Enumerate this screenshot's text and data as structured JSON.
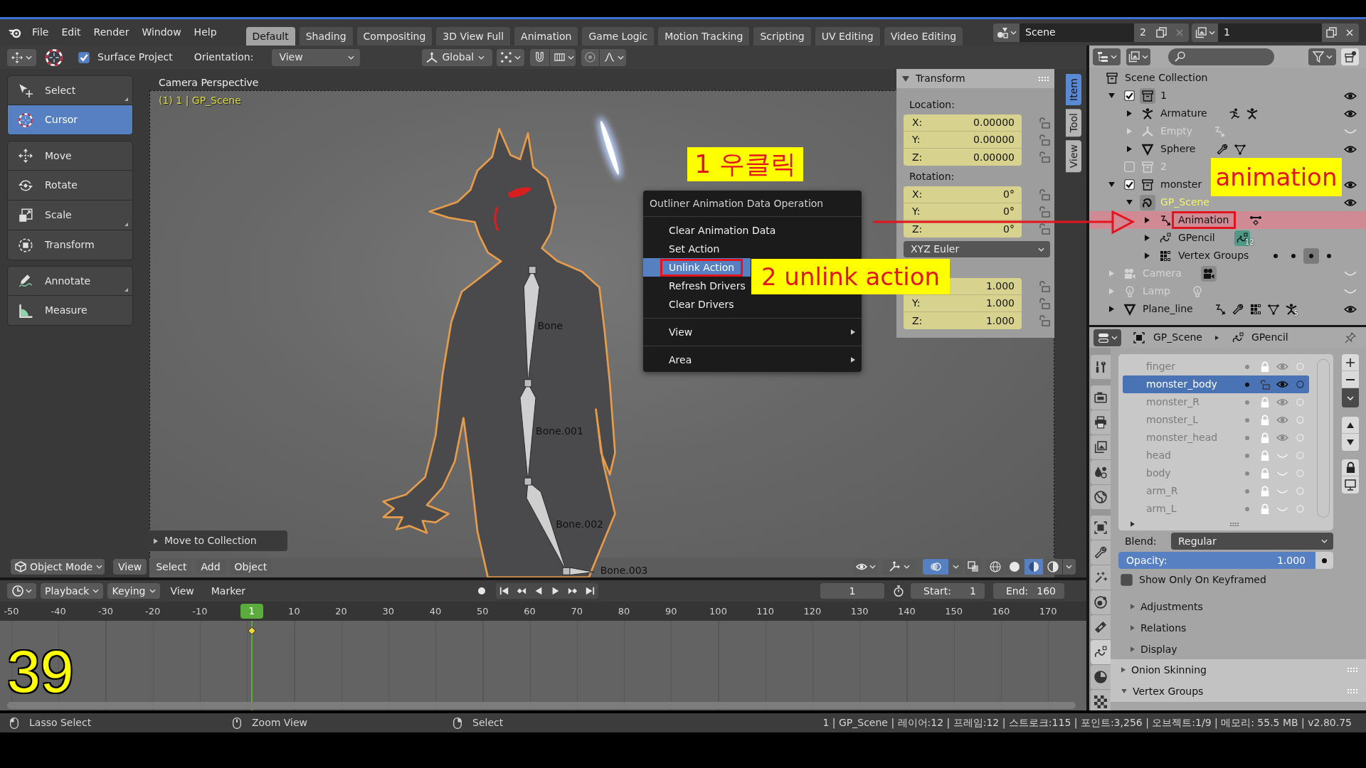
{
  "top_bar": {
    "menus": [
      "File",
      "Edit",
      "Render",
      "Window",
      "Help"
    ],
    "workspaces": [
      {
        "label": "Default",
        "selected": true
      },
      {
        "label": "Shading",
        "selected": false
      },
      {
        "label": "Compositing",
        "selected": false
      },
      {
        "label": "3D View Full",
        "selected": false
      },
      {
        "label": "Animation",
        "selected": false
      },
      {
        "label": "Game Logic",
        "selected": false
      },
      {
        "label": "Motion Tracking",
        "selected": false
      },
      {
        "label": "Scripting",
        "selected": false
      },
      {
        "label": "UV Editing",
        "selected": false
      },
      {
        "label": "Video Editing",
        "selected": false
      }
    ],
    "scene": {
      "name": "Scene",
      "users": "2"
    },
    "view_layer": {
      "name": "1"
    }
  },
  "tool_header": {
    "surface_project": {
      "label": "Surface Project",
      "checked": true
    },
    "orientation": {
      "label": "Orientation:",
      "value": "View"
    },
    "transform_orientation": "Global"
  },
  "toolbar": {
    "groups": [
      {
        "tools": [
          {
            "label": "Select",
            "kind": "select",
            "selected": false,
            "more": true
          },
          {
            "label": "Cursor",
            "kind": "cursor",
            "selected": true,
            "more": false
          }
        ]
      },
      {
        "tools": [
          {
            "label": "Move",
            "kind": "move",
            "selected": false,
            "more": false
          },
          {
            "label": "Rotate",
            "kind": "rotate",
            "selected": false,
            "more": false
          },
          {
            "label": "Scale",
            "kind": "scale",
            "selected": false,
            "more": true
          },
          {
            "label": "Transform",
            "kind": "transform",
            "selected": false,
            "more": false
          }
        ]
      },
      {
        "tools": [
          {
            "label": "Annotate",
            "kind": "annotate",
            "selected": false,
            "more": true
          },
          {
            "label": "Measure",
            "kind": "measure",
            "selected": false,
            "more": false
          }
        ]
      }
    ]
  },
  "viewport": {
    "view_name": "Camera Perspective",
    "object_info": "(1) 1 | GP_Scene",
    "bones": [
      {
        "label": "Bone"
      },
      {
        "label": "Bone.001"
      },
      {
        "label": "Bone.002"
      },
      {
        "label": "Bone.003"
      }
    ],
    "last_operator": {
      "label": "Move to Collection",
      "expanded": false
    },
    "header": {
      "mode": "Object Mode",
      "menus": [
        "View",
        "Select",
        "Add",
        "Object"
      ],
      "toggles": [
        {
          "kind": "overlays",
          "on": true
        },
        {
          "kind": "xray",
          "on": false
        }
      ],
      "shading": [
        {
          "kind": "wireframe",
          "selected": false
        },
        {
          "kind": "solid",
          "selected": false
        },
        {
          "kind": "material",
          "selected": true
        },
        {
          "kind": "rendered",
          "selected": false
        }
      ]
    }
  },
  "sidebar": {
    "tabs": [
      {
        "label": "Item",
        "selected": true
      },
      {
        "label": "Tool",
        "selected": false
      },
      {
        "label": "View",
        "selected": false
      }
    ],
    "transform": {
      "title": "Transform",
      "expanded": true,
      "location": {
        "label": "Location:",
        "fields": [
          {
            "axis": "X:",
            "value": "0.00000",
            "keyed": true,
            "locked": false
          },
          {
            "axis": "Y:",
            "value": "0.00000",
            "keyed": true,
            "locked": false
          },
          {
            "axis": "Z:",
            "value": "0.00000",
            "keyed": true,
            "locked": false
          }
        ]
      },
      "rotation": {
        "label": "Rotation:",
        "fields": [
          {
            "axis": "X:",
            "value": "0°",
            "keyed": true,
            "locked": false
          },
          {
            "axis": "Y:",
            "value": "0°",
            "keyed": true,
            "locked": false
          },
          {
            "axis": "Z:",
            "value": "0°",
            "keyed": true,
            "locked": false
          }
        ],
        "mode": "XYZ Euler"
      },
      "scale": {
        "fields": [
          {
            "value": "1.000",
            "keyed": true,
            "locked": false
          },
          {
            "axis": "Y:",
            "value": "1.000",
            "keyed": true,
            "locked": false
          },
          {
            "axis": "Z:",
            "value": "1.000",
            "keyed": true,
            "locked": false
          }
        ]
      }
    }
  },
  "context_menu": {
    "title": "Outliner Animation Data Operation",
    "sections": [
      {
        "items": [
          {
            "label": "Clear Animation Data",
            "selected": false,
            "marked": false,
            "submenu": false
          },
          {
            "label": "Set Action",
            "selected": false,
            "marked": false,
            "submenu": false
          },
          {
            "label": "Unlink Action",
            "selected": true,
            "marked": true,
            "submenu": false
          },
          {
            "label": "Refresh Drivers",
            "selected": false,
            "marked": false,
            "submenu": false
          },
          {
            "label": "Clear Drivers",
            "selected": false,
            "marked": false,
            "submenu": false
          }
        ]
      },
      {
        "items": [
          {
            "label": "View",
            "selected": false,
            "marked": false,
            "submenu": true
          }
        ]
      },
      {
        "items": [
          {
            "label": "Area",
            "selected": false,
            "marked": false,
            "submenu": true
          }
        ]
      }
    ]
  },
  "annotations": [
    {
      "kind": "step",
      "text": "1 우클릭"
    },
    {
      "kind": "step",
      "text": "2 unlink action"
    },
    {
      "kind": "callout",
      "text": "animation"
    },
    {
      "kind": "page",
      "text": "39"
    }
  ],
  "outliner": {
    "root": {
      "label": "Scene Collection",
      "kind": "scene_collection",
      "selected": false,
      "active": false,
      "dimmed": false,
      "marked": false,
      "children": [
        {
          "label": "1",
          "kind": "collection",
          "expanded": true,
          "checked": true,
          "visible": true,
          "selected": false,
          "active": true,
          "dimmed": false,
          "marked": false,
          "children": [
            {
              "label": "Armature",
              "kind": "armature",
              "expanded": false,
              "visible": true,
              "selected": false,
              "active": false,
              "dimmed": false,
              "marked": false,
              "extras": [
                {
                  "kind": "pose",
                  "active": false
                },
                {
                  "kind": "armature",
                  "active": false
                }
              ]
            },
            {
              "label": "Empty",
              "kind": "empty",
              "expanded": false,
              "visible": false,
              "selected": false,
              "active": false,
              "dimmed": true,
              "marked": false,
              "extras": [
                {
                  "kind": "action",
                  "active": false
                }
              ]
            },
            {
              "label": "Sphere",
              "kind": "mesh",
              "expanded": false,
              "visible": true,
              "selected": false,
              "active": false,
              "dimmed": false,
              "marked": false,
              "extras": [
                {
                  "kind": "modifier",
                  "active": false
                },
                {
                  "kind": "mesh_data",
                  "active": false
                }
              ]
            }
          ]
        },
        {
          "label": "2",
          "kind": "collection",
          "checked": false,
          "selected": false,
          "active": false,
          "dimmed": true,
          "marked": false
        },
        {
          "label": "monster",
          "kind": "collection",
          "expanded": true,
          "checked": true,
          "visible": true,
          "selected": false,
          "active": false,
          "dimmed": false,
          "marked": false,
          "children": [
            {
              "label": "GP_Scene",
              "kind": "gpencil",
              "expanded": true,
              "visible": true,
              "selected": false,
              "active": true,
              "dimmed": false,
              "marked": false,
              "children": [
                {
                  "label": "Animation",
                  "kind": "action",
                  "expanded": false,
                  "selected": true,
                  "active": false,
                  "dimmed": false,
                  "marked": true,
                  "extras": [
                    {
                      "kind": "keyframes",
                      "active": false
                    }
                  ]
                },
                {
                  "label": "GPencil",
                  "kind": "gpencil_data",
                  "expanded": false,
                  "selected": false,
                  "active": false,
                  "dimmed": false,
                  "marked": false,
                  "extras": [
                    {
                      "kind": "gpencil_data",
                      "count": "12",
                      "active": true
                    }
                  ]
                },
                {
                  "label": "Vertex Groups",
                  "kind": "vertex_groups",
                  "expanded": false,
                  "selected": false,
                  "active": false,
                  "dimmed": false,
                  "marked": false,
                  "extras": [
                    {
                      "kind": "dot",
                      "active": false
                    },
                    {
                      "kind": "dot",
                      "active": false
                    },
                    {
                      "kind": "dot",
                      "active": true
                    },
                    {
                      "kind": "dot",
                      "active": false
                    }
                  ]
                }
              ]
            }
          ]
        },
        {
          "label": "Camera",
          "kind": "camera",
          "expanded": false,
          "visible": false,
          "selected": false,
          "active": false,
          "dimmed": true,
          "marked": false,
          "extras": [
            {
              "kind": "camera_data",
              "active": true
            }
          ]
        },
        {
          "label": "Lamp",
          "kind": "lamp",
          "expanded": false,
          "visible": false,
          "selected": false,
          "active": false,
          "dimmed": true,
          "marked": false,
          "extras": [
            {
              "kind": "lamp_data",
              "active": false
            }
          ]
        },
        {
          "label": "Plane_line",
          "kind": "mesh",
          "expanded": false,
          "visible": true,
          "selected": false,
          "active": false,
          "dimmed": false,
          "marked": false,
          "extras": [
            {
              "kind": "action",
              "active": false
            },
            {
              "kind": "modifier",
              "active": false
            },
            {
              "kind": "vertex_groups",
              "active": false
            },
            {
              "kind": "mesh_data",
              "active": false
            },
            {
              "kind": "armature",
              "count": "5",
              "active": false
            }
          ]
        }
      ]
    }
  },
  "properties": {
    "context": [
      {
        "label": "GP_Scene",
        "kind": "object"
      },
      {
        "label": "GPencil",
        "kind": "gpencil_data"
      }
    ],
    "tab_groups": [
      {
        "tabs": [
          {
            "kind": "tool",
            "selected": false
          }
        ]
      },
      {
        "tabs": [
          {
            "kind": "render",
            "selected": false
          },
          {
            "kind": "output",
            "selected": false
          },
          {
            "kind": "view_layer",
            "selected": false
          },
          {
            "kind": "scene",
            "selected": false
          },
          {
            "kind": "world",
            "selected": false
          }
        ]
      },
      {
        "tabs": [
          {
            "kind": "object",
            "selected": false
          },
          {
            "kind": "modifiers",
            "selected": false
          },
          {
            "kind": "effects",
            "selected": false
          },
          {
            "kind": "physics",
            "selected": false
          },
          {
            "kind": "constraints",
            "selected": false
          },
          {
            "kind": "data",
            "selected": true
          },
          {
            "kind": "material",
            "selected": false
          },
          {
            "kind": "texture",
            "selected": false
          }
        ]
      }
    ],
    "layers": [
      {
        "name": "finger",
        "selected": false,
        "locked": true,
        "visible": true
      },
      {
        "name": "monster_body",
        "selected": true,
        "locked": false,
        "visible": true
      },
      {
        "name": "monster_R",
        "selected": false,
        "locked": true,
        "visible": true
      },
      {
        "name": "monster_L",
        "selected": false,
        "locked": true,
        "visible": true
      },
      {
        "name": "monster_head",
        "selected": false,
        "locked": true,
        "visible": true
      },
      {
        "name": "head",
        "selected": false,
        "locked": true,
        "visible": false
      },
      {
        "name": "body",
        "selected": false,
        "locked": true,
        "visible": false
      },
      {
        "name": "arm_R",
        "selected": false,
        "locked": true,
        "visible": false
      },
      {
        "name": "arm_L",
        "selected": false,
        "locked": true,
        "visible": false
      }
    ],
    "blend": {
      "label": "Blend:",
      "value": "Regular"
    },
    "opacity": {
      "label": "Opacity:",
      "value": "1.000",
      "level": 1
    },
    "keyframed_only": {
      "label": "Show Only On Keyframed",
      "checked": false
    },
    "subpanels": [
      {
        "label": "Adjustments",
        "expanded": false
      },
      {
        "label": "Relations",
        "expanded": false
      },
      {
        "label": "Display",
        "expanded": false
      }
    ],
    "panels": [
      {
        "label": "Onion Skinning",
        "expanded": false
      },
      {
        "label": "Vertex Groups",
        "expanded": true
      }
    ]
  },
  "timeline": {
    "menus": [
      {
        "label": "Playback",
        "dropdown": true
      },
      {
        "label": "Keying",
        "dropdown": true
      },
      {
        "label": "View",
        "dropdown": false
      },
      {
        "label": "Marker",
        "dropdown": false
      }
    ],
    "current_frame": "1",
    "start": {
      "label": "Start:",
      "value": "1"
    },
    "end": {
      "label": "End:",
      "value": "160"
    },
    "ruler": [
      "-50",
      "-40",
      "-30",
      "-20",
      "-10",
      "10",
      "20",
      "30",
      "40",
      "50",
      "60",
      "70",
      "80",
      "90",
      "100",
      "110",
      "120",
      "130",
      "140",
      "150",
      "160",
      "170"
    ],
    "playhead": "1"
  },
  "status_bar": {
    "hints": [
      {
        "kind": "left",
        "label": "Lasso Select"
      },
      {
        "kind": "middle",
        "label": "Zoom View"
      },
      {
        "kind": "right",
        "label": "Select"
      }
    ],
    "stats": "1 | GP_Scene | 레이어:12 | 프레임:12 | 스트로크:115 | 포인트:3,256 | 오브젝트:1/9 | 메모리: 55.5 MB | v2.80.75"
  }
}
